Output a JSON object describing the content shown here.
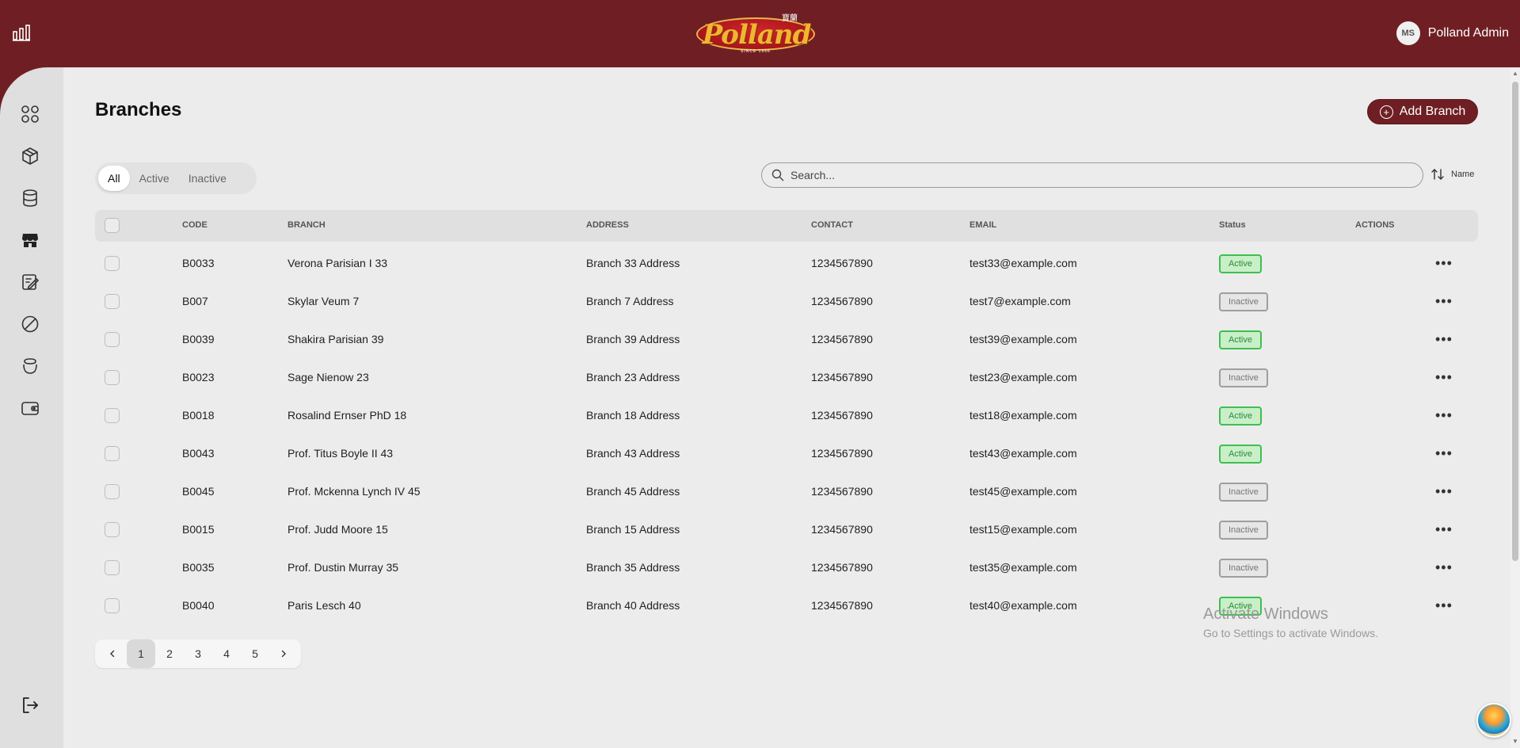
{
  "header": {
    "brand": "Polland",
    "brand_since": "SINCE 1966",
    "brand_chinese": "寶蘭",
    "user_initials": "MS",
    "user_name": "Polland Admin"
  },
  "sidebar": {
    "items": [
      {
        "name": "dashboard",
        "icon": "grid-icon"
      },
      {
        "name": "products",
        "icon": "box-icon"
      },
      {
        "name": "database",
        "icon": "database-icon"
      },
      {
        "name": "branches",
        "icon": "store-icon",
        "active": true
      },
      {
        "name": "notes",
        "icon": "edit-note-icon"
      },
      {
        "name": "blocked",
        "icon": "ban-icon"
      },
      {
        "name": "orders",
        "icon": "pot-icon"
      },
      {
        "name": "wallet",
        "icon": "wallet-icon"
      }
    ],
    "logout_icon": "logout-icon"
  },
  "page": {
    "title": "Branches",
    "add_button": "Add Branch"
  },
  "filters": {
    "tabs": [
      "All",
      "Active",
      "Inactive"
    ],
    "selected": "All"
  },
  "search": {
    "placeholder": "Search...",
    "value": ""
  },
  "sort": {
    "label": "Name"
  },
  "table": {
    "columns": [
      "CODE",
      "BRANCH",
      "ADDRESS",
      "CONTACT",
      "EMAIL",
      "Status",
      "ACTIONS"
    ],
    "rows": [
      {
        "code": "B0033",
        "branch": "Verona Parisian I 33",
        "address": "Branch 33 Address",
        "contact": "1234567890",
        "email": "test33@example.com",
        "status": "Active"
      },
      {
        "code": "B007",
        "branch": "Skylar Veum 7",
        "address": "Branch 7 Address",
        "contact": "1234567890",
        "email": "test7@example.com",
        "status": "Inactive"
      },
      {
        "code": "B0039",
        "branch": "Shakira Parisian 39",
        "address": "Branch 39 Address",
        "contact": "1234567890",
        "email": "test39@example.com",
        "status": "Active"
      },
      {
        "code": "B0023",
        "branch": "Sage Nienow 23",
        "address": "Branch 23 Address",
        "contact": "1234567890",
        "email": "test23@example.com",
        "status": "Inactive"
      },
      {
        "code": "B0018",
        "branch": "Rosalind Ernser PhD 18",
        "address": "Branch 18 Address",
        "contact": "1234567890",
        "email": "test18@example.com",
        "status": "Active"
      },
      {
        "code": "B0043",
        "branch": "Prof. Titus Boyle II 43",
        "address": "Branch 43 Address",
        "contact": "1234567890",
        "email": "test43@example.com",
        "status": "Active"
      },
      {
        "code": "B0045",
        "branch": "Prof. Mckenna Lynch IV 45",
        "address": "Branch 45 Address",
        "contact": "1234567890",
        "email": "test45@example.com",
        "status": "Inactive"
      },
      {
        "code": "B0015",
        "branch": "Prof. Judd Moore 15",
        "address": "Branch 15 Address",
        "contact": "1234567890",
        "email": "test15@example.com",
        "status": "Inactive"
      },
      {
        "code": "B0035",
        "branch": "Prof. Dustin Murray 35",
        "address": "Branch 35 Address",
        "contact": "1234567890",
        "email": "test35@example.com",
        "status": "Inactive"
      },
      {
        "code": "B0040",
        "branch": "Paris Lesch 40",
        "address": "Branch 40 Address",
        "contact": "1234567890",
        "email": "test40@example.com",
        "status": "Active"
      }
    ]
  },
  "pagination": {
    "pages": [
      "1",
      "2",
      "3",
      "4",
      "5"
    ],
    "current": "1"
  },
  "watermark": {
    "line1": "Activate Windows",
    "line2": "Go to Settings to activate Windows."
  },
  "colors": {
    "brand": "#6f1f23",
    "active_badge": "#3fbf4f",
    "inactive_badge": "#9e9e9e"
  }
}
